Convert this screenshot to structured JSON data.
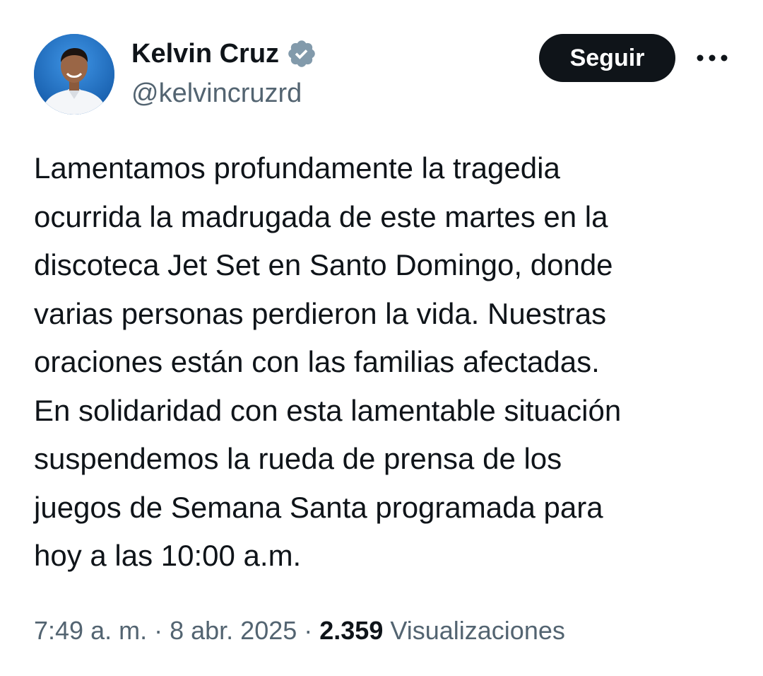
{
  "author": {
    "name": "Kelvin Cruz",
    "handle": "@kelvincruzrd",
    "avatar_icon": "profile-photo",
    "verified_icon": "verified-badge-icon",
    "verified_color": "#829aab"
  },
  "actions": {
    "follow_label": "Seguir",
    "more_icon": "more-horizontal-icon"
  },
  "post": {
    "lines": [
      "Lamentamos profundamente la tragedia",
      "ocurrida la madrugada de este martes en la",
      "discoteca Jet Set en Santo Domingo, donde",
      "varias personas perdieron la vida. Nuestras",
      "oraciones están con las familias afectadas.",
      "En solidaridad con esta lamentable situación",
      "suspendemos la rueda de prensa de los",
      "juegos de Semana Santa programada para",
      "hoy a las 10:00 a.m."
    ]
  },
  "meta": {
    "time": "7:49 a. m.",
    "separator": " · ",
    "date": "8 abr. 2025",
    "views_count": "2.359",
    "views_label": "Visualizaciones"
  },
  "colors": {
    "text_primary": "#0f1419",
    "text_secondary": "#536471",
    "button_bg": "#0f1419",
    "avatar_bg": "#1f6fc4"
  }
}
